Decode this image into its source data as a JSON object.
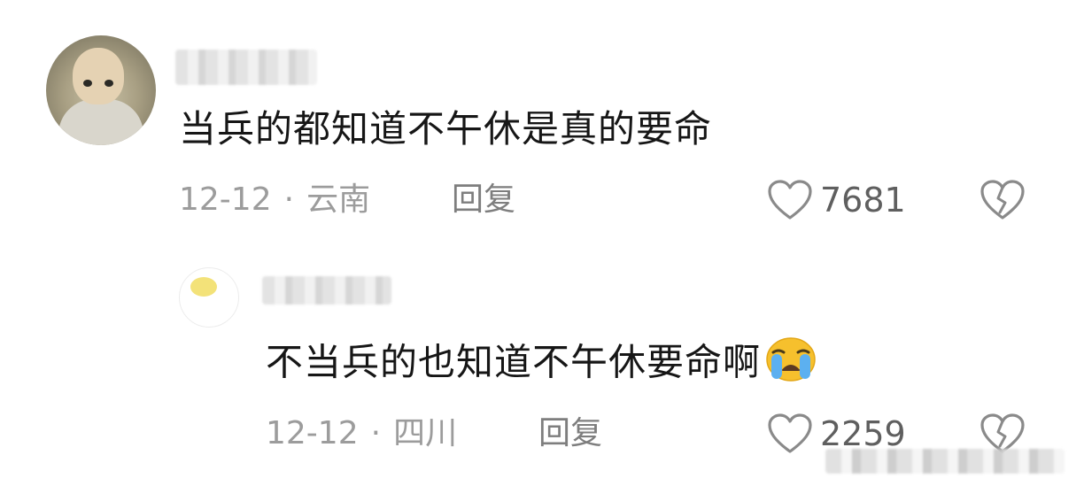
{
  "comments": [
    {
      "text": "当兵的都知道不午休是真的要命",
      "date": "12-12",
      "location": "云南",
      "reply_label": "回复",
      "likes": "7681",
      "avatar": "baby-photo-avatar"
    },
    {
      "text": "不当兵的也知道不午休要命啊",
      "emoji": "crying-face-emoji",
      "date": "12-12",
      "location": "四川",
      "reply_label": "回复",
      "likes": "2259",
      "avatar": "cartoon-sticker-avatar"
    }
  ],
  "separator": "·",
  "colors": {
    "text": "#161616",
    "meta": "#9c9c9c",
    "icon": "#8a8a8a",
    "background": "#ffffff"
  }
}
